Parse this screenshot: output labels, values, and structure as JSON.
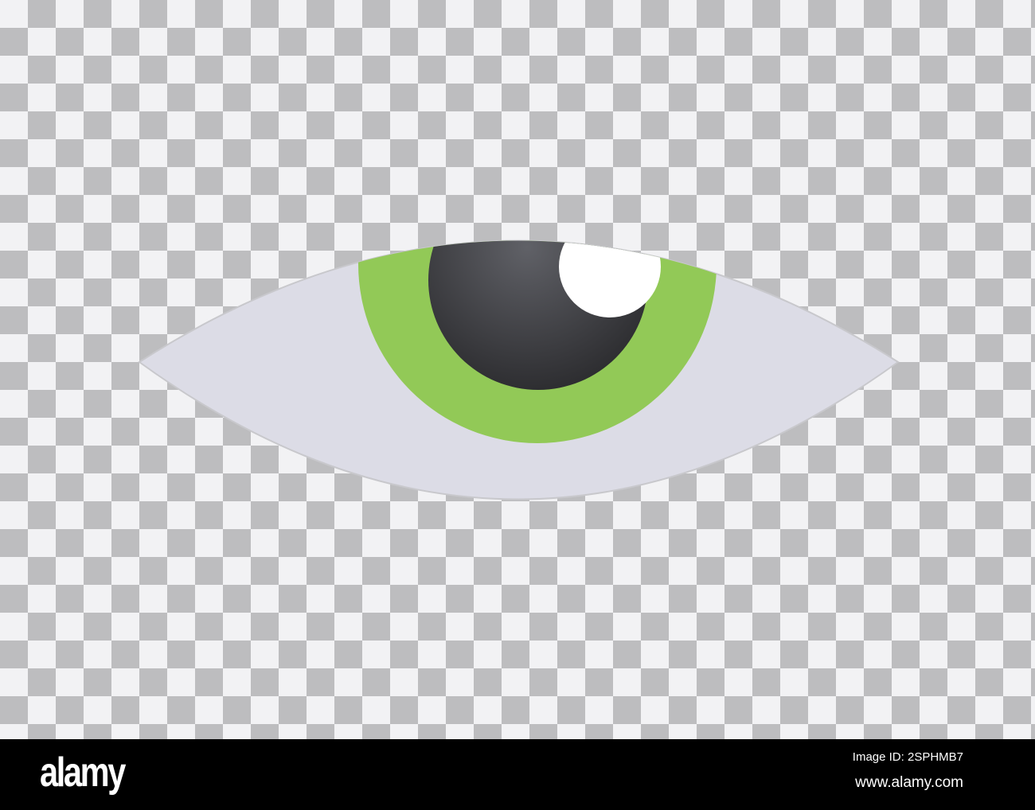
{
  "illustration": {
    "subject": "eye",
    "colors": {
      "sclera": "#dcdce6",
      "iris": "#92c957",
      "pupil": "#4a4b50",
      "highlight": "#ffffff",
      "checker_light": "#f2f2f4",
      "checker_dark": "#bdbdbf"
    }
  },
  "watermark": "alamy",
  "footer": {
    "logo": "alamy",
    "image_id": "Image ID: 2SPHMB7",
    "url": "www.alamy.com"
  }
}
